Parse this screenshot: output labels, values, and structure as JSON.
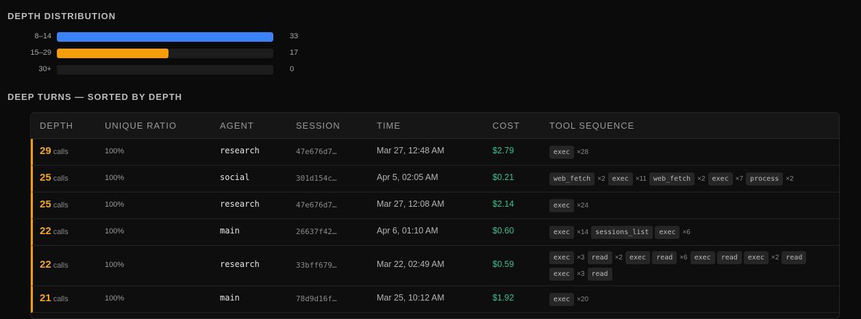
{
  "distribution": {
    "title": "DEPTH DISTRIBUTION",
    "rows": [
      {
        "label": "8–14",
        "count": "33",
        "fraction": 1.0,
        "color": "#3b82f6"
      },
      {
        "label": "15–29",
        "count": "17",
        "fraction": 0.515,
        "color": "#f59e0b"
      },
      {
        "label": "30+",
        "count": "0",
        "fraction": 0.0,
        "color": "#3b82f6"
      }
    ]
  },
  "deep_turns": {
    "title": "DEEP TURNS — SORTED BY DEPTH",
    "columns": [
      "DEPTH",
      "UNIQUE RATIO",
      "AGENT",
      "SESSION",
      "TIME",
      "COST",
      "TOOL SEQUENCE"
    ],
    "depth_unit": "calls",
    "rows": [
      {
        "depth": "29",
        "ratio": "100%",
        "agent": "research",
        "session": "47e676d7…",
        "time": "Mar 27, 12:48 AM",
        "cost": "$2.79",
        "tools": [
          {
            "name": "exec",
            "mult": "×28"
          }
        ]
      },
      {
        "depth": "25",
        "ratio": "100%",
        "agent": "social",
        "session": "301d154c…",
        "time": "Apr 5, 02:05 AM",
        "cost": "$0.21",
        "tools": [
          {
            "name": "web_fetch",
            "mult": "×2"
          },
          {
            "name": "exec",
            "mult": "×11"
          },
          {
            "name": "web_fetch",
            "mult": "×2"
          },
          {
            "name": "exec",
            "mult": "×7"
          },
          {
            "name": "process",
            "mult": "×2"
          }
        ]
      },
      {
        "depth": "25",
        "ratio": "100%",
        "agent": "research",
        "session": "47e676d7…",
        "time": "Mar 27, 12:08 AM",
        "cost": "$2.14",
        "tools": [
          {
            "name": "exec",
            "mult": "×24"
          }
        ]
      },
      {
        "depth": "22",
        "ratio": "100%",
        "agent": "main",
        "session": "26637f42…",
        "time": "Apr 6, 01:10 AM",
        "cost": "$0.60",
        "tools": [
          {
            "name": "exec",
            "mult": "×14"
          },
          {
            "name": "sessions_list",
            "mult": ""
          },
          {
            "name": "exec",
            "mult": "×6"
          }
        ]
      },
      {
        "depth": "22",
        "ratio": "100%",
        "agent": "research",
        "session": "33bff679…",
        "time": "Mar 22, 02:49 AM",
        "cost": "$0.59",
        "tools": [
          {
            "name": "exec",
            "mult": "×3"
          },
          {
            "name": "read",
            "mult": "×2"
          },
          {
            "name": "exec",
            "mult": ""
          },
          {
            "name": "read",
            "mult": "×6"
          },
          {
            "name": "exec",
            "mult": ""
          },
          {
            "name": "read",
            "mult": ""
          },
          {
            "name": "exec",
            "mult": "×2"
          },
          {
            "name": "read",
            "mult": ""
          },
          {
            "name": "exec",
            "mult": "×3"
          },
          {
            "name": "read",
            "mult": ""
          }
        ]
      },
      {
        "depth": "21",
        "ratio": "100%",
        "agent": "main",
        "session": "78d9d16f…",
        "time": "Mar 25, 10:12 AM",
        "cost": "$1.92",
        "tools": [
          {
            "name": "exec",
            "mult": "×20"
          }
        ]
      }
    ]
  }
}
